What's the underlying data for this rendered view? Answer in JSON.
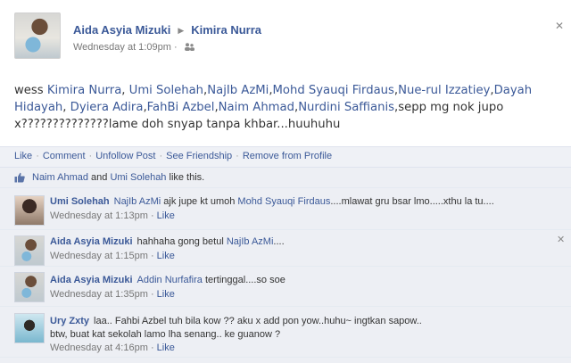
{
  "post": {
    "author": "Aida Asyia Mizuki",
    "target": "Kimira Nurra",
    "timestamp": "Wednesday at 1:09pm",
    "message": [
      {
        "t": "text",
        "v": "wess "
      },
      {
        "t": "link",
        "v": "Kimira Nurra"
      },
      {
        "t": "text",
        "v": ", "
      },
      {
        "t": "link",
        "v": "Umi Solehah"
      },
      {
        "t": "text",
        "v": ","
      },
      {
        "t": "link",
        "v": "NajIb AzMi"
      },
      {
        "t": "text",
        "v": ","
      },
      {
        "t": "link",
        "v": "Mohd Syauqi Firdaus"
      },
      {
        "t": "text",
        "v": ","
      },
      {
        "t": "link",
        "v": "Nue-rul Izzatiey"
      },
      {
        "t": "text",
        "v": ","
      },
      {
        "t": "link",
        "v": "Dayah Hidayah"
      },
      {
        "t": "text",
        "v": ", "
      },
      {
        "t": "link",
        "v": "Dyiera Adira"
      },
      {
        "t": "text",
        "v": ","
      },
      {
        "t": "link",
        "v": "FahBi Azbel"
      },
      {
        "t": "text",
        "v": ","
      },
      {
        "t": "link",
        "v": "Naim Ahmad"
      },
      {
        "t": "text",
        "v": ","
      },
      {
        "t": "link",
        "v": "Nurdini Saffianis"
      },
      {
        "t": "text",
        "v": ",sepp mg nok jupo x??????????????lame doh snyap tanpa khbar...huuhuhu"
      }
    ]
  },
  "actions": [
    "Like",
    "Comment",
    "Unfollow Post",
    "See Friendship",
    "Remove from Profile"
  ],
  "likes": {
    "user1": "Naim Ahmad",
    "and": " and ",
    "user2": "Umi Solehah",
    "suffix": " like this."
  },
  "comments": [
    {
      "author": "Umi Solehah",
      "parts": [
        {
          "t": "link",
          "v": "NajIb AzMi"
        },
        {
          "t": "text",
          "v": " ajk jupe kt umoh "
        },
        {
          "t": "link",
          "v": "Mohd Syauqi Firdaus"
        },
        {
          "t": "text",
          "v": "....mlawat gru bsar lmo.....xthu la tu...."
        }
      ],
      "time": "Wednesday at 1:13pm",
      "like": "Like"
    },
    {
      "author": "Aida Asyia Mizuki",
      "parts": [
        {
          "t": "text",
          "v": "hahhaha gong betul "
        },
        {
          "t": "link",
          "v": "NajIb AzMi"
        },
        {
          "t": "text",
          "v": "...."
        }
      ],
      "time": "Wednesday at 1:15pm",
      "like": "Like"
    },
    {
      "author": "Aida Asyia Mizuki",
      "parts": [
        {
          "t": "link",
          "v": "Addin Nurfafira"
        },
        {
          "t": "text",
          "v": " tertinggal....so soe"
        }
      ],
      "time": "Wednesday at 1:35pm",
      "like": "Like"
    },
    {
      "author": "Ury Zxty",
      "parts": [
        {
          "t": "text",
          "v": "laa.. Fahbi Azbel tuh bila kow ?? aku x add pon yow..huhu~ ingtkan sapow.."
        }
      ],
      "line2": "btw, buat kat sekolah lamo lha senang.. ke guanow ?",
      "time": "Wednesday at 4:16pm",
      "like": "Like"
    }
  ],
  "separator": "·",
  "icons": {
    "close": "close-icon",
    "friends": "friends-icon",
    "thumb": "thumbs-up-icon",
    "arrow": "arrow-right-icon"
  },
  "colors": {
    "link": "#3b5998",
    "commentBg": "#edeff4"
  }
}
